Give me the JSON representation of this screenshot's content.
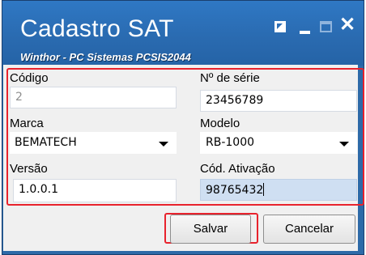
{
  "window": {
    "title": "Cadastro SAT",
    "subtitle": "Winthor - PC Sistemas  PCSIS2044",
    "controls": {
      "restore": "restore-icon",
      "minimize": "minimize-icon",
      "maximize": "maximize-icon",
      "close": "✕"
    }
  },
  "form": {
    "codigo": {
      "label": "Código",
      "value": "2"
    },
    "serie": {
      "label": "Nº de série",
      "value": "23456789"
    },
    "marca": {
      "label": "Marca",
      "value": "BEMATECH"
    },
    "modelo": {
      "label": "Modelo",
      "value": "RB-1000"
    },
    "versao": {
      "label": "Versão",
      "value": "1.0.0.1"
    },
    "ativacao": {
      "label": "Cód. Ativação",
      "value": "98765432"
    }
  },
  "buttons": {
    "save": "Salvar",
    "cancel": "Cancelar"
  },
  "colors": {
    "titlebar": "#2a6bb1",
    "highlight": "#e8232d",
    "active_field": "#cfdff2"
  }
}
